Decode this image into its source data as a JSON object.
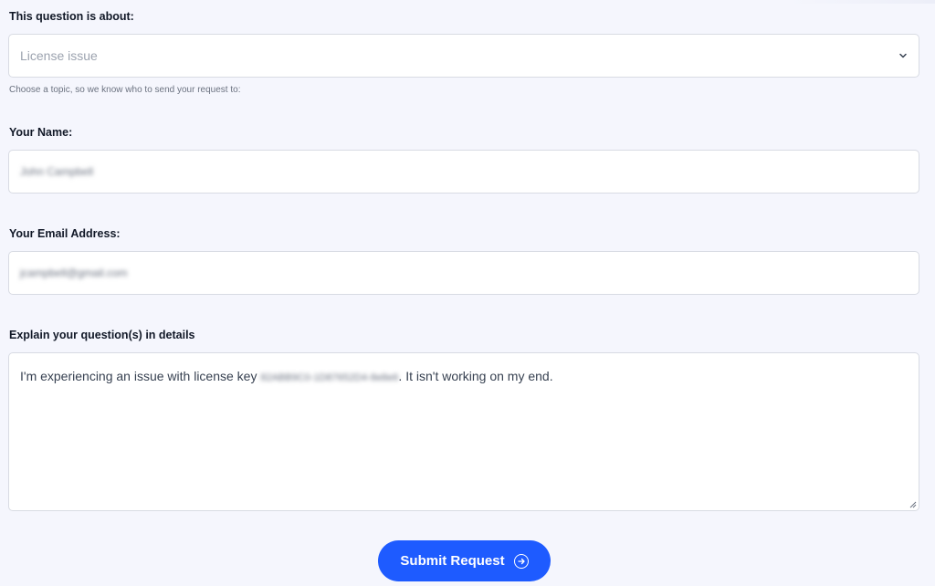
{
  "topic": {
    "label": "This question is about:",
    "selected": "License issue",
    "hint": "Choose a topic, so we know who to send your request to:"
  },
  "name": {
    "label": "Your Name:",
    "value": "John Campbell"
  },
  "email": {
    "label": "Your Email Address:",
    "value": "jcampbell@gmail.com"
  },
  "details": {
    "label": "Explain your question(s) in details",
    "text_before": "I'm experiencing an issue with license key ",
    "license_key": "82ABB9C0-1D87652D4-8e8e6",
    "text_after": ". It isn't working on my end."
  },
  "submit": {
    "label": "Submit Request",
    "icon": "arrow-right-circle-icon"
  },
  "colors": {
    "background": "#f5f6fd",
    "accent": "#1e5bff"
  }
}
